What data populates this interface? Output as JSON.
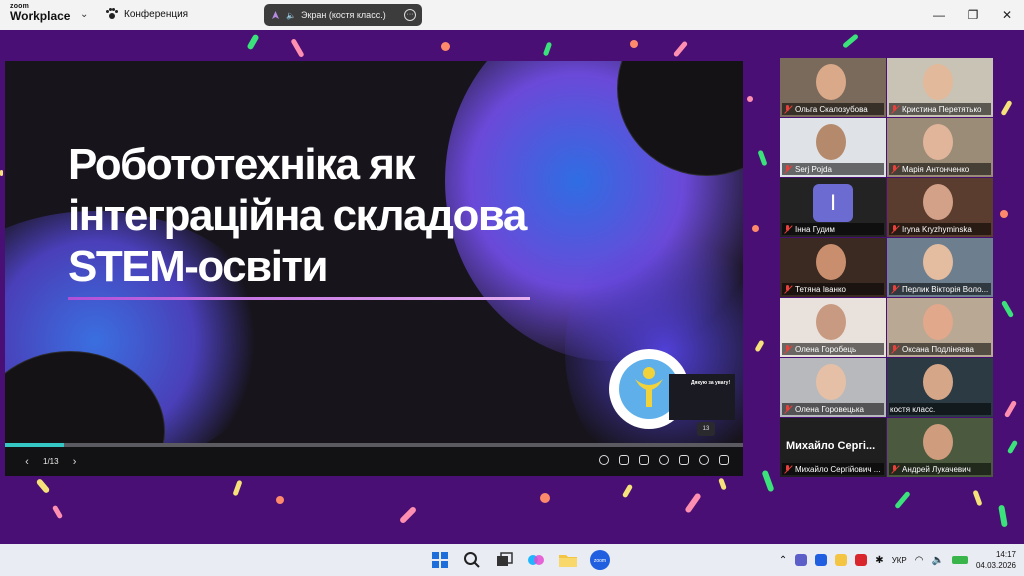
{
  "app": {
    "logo_small": "zoom",
    "logo_big": "Workplace",
    "conference_label": "Конференция",
    "share_label": "Экран (костя класс.)"
  },
  "window_controls": [
    "minimize",
    "restore",
    "close"
  ],
  "slide": {
    "title_lines": [
      "Робототехніка як",
      "інтеграційна складова",
      "STEM-освіти"
    ],
    "mini_title": "Дякую за увагу!",
    "page_badge": "13",
    "progress": 0.08,
    "page_indicator": "1/13"
  },
  "participants": [
    {
      "name": "Ольга Скалозубова",
      "muted": true,
      "bg": "#7a6a5c",
      "face": "#d9a98a"
    },
    {
      "name": "Кристина Перетятько",
      "muted": true,
      "bg": "#c9c3b6",
      "face": "#e2b99a"
    },
    {
      "name": "Serj Pojda",
      "muted": true,
      "bg": "#dfe2e6",
      "face": "#b58a6c"
    },
    {
      "name": "Марія Антонченко",
      "muted": true,
      "bg": "#9b8c78",
      "face": "#e0b59a"
    },
    {
      "name": "Інна Гудим",
      "muted": true,
      "avatar": "І"
    },
    {
      "name": "Iryna Kryzhyminska",
      "muted": true,
      "bg": "#5a3d2e",
      "face": "#d3a088"
    },
    {
      "name": "Тетяна Іванко",
      "muted": true,
      "bg": "#3a2a22",
      "face": "#c88e6e"
    },
    {
      "name": "Перлик Вікторія Воло...",
      "muted": true,
      "bg": "#6d7f8e",
      "face": "#e4bca0"
    },
    {
      "name": "Олена Горобець",
      "muted": true,
      "bg": "#e9e2dc",
      "face": "#c99a82"
    },
    {
      "name": "Оксана Подліняєва",
      "muted": true,
      "bg": "#b9a894",
      "face": "#e1a88c",
      "active": true
    },
    {
      "name": "Олена Горовецька",
      "muted": true,
      "bg": "#b8b9bd",
      "face": "#e5c0a6"
    },
    {
      "name": "костя класс.",
      "muted": false,
      "bg": "#2c3a44",
      "face": "#d6a688"
    },
    {
      "name": "Михайло Сергійович ...",
      "muted": true,
      "bigname": "Михайло  Сергі..."
    },
    {
      "name": "Андрей Лукачевич",
      "muted": true,
      "bg": "#4b5a3e",
      "face": "#cf9c7e"
    }
  ],
  "taskbar": {
    "lang": "УКР",
    "time": "14:17",
    "date": "04.03.2026"
  },
  "colors": {
    "background": "#4a0f74",
    "accent_teal": "#35c7c4",
    "mic_off": "#e8403b",
    "active_speaker": "#2ec96d"
  }
}
